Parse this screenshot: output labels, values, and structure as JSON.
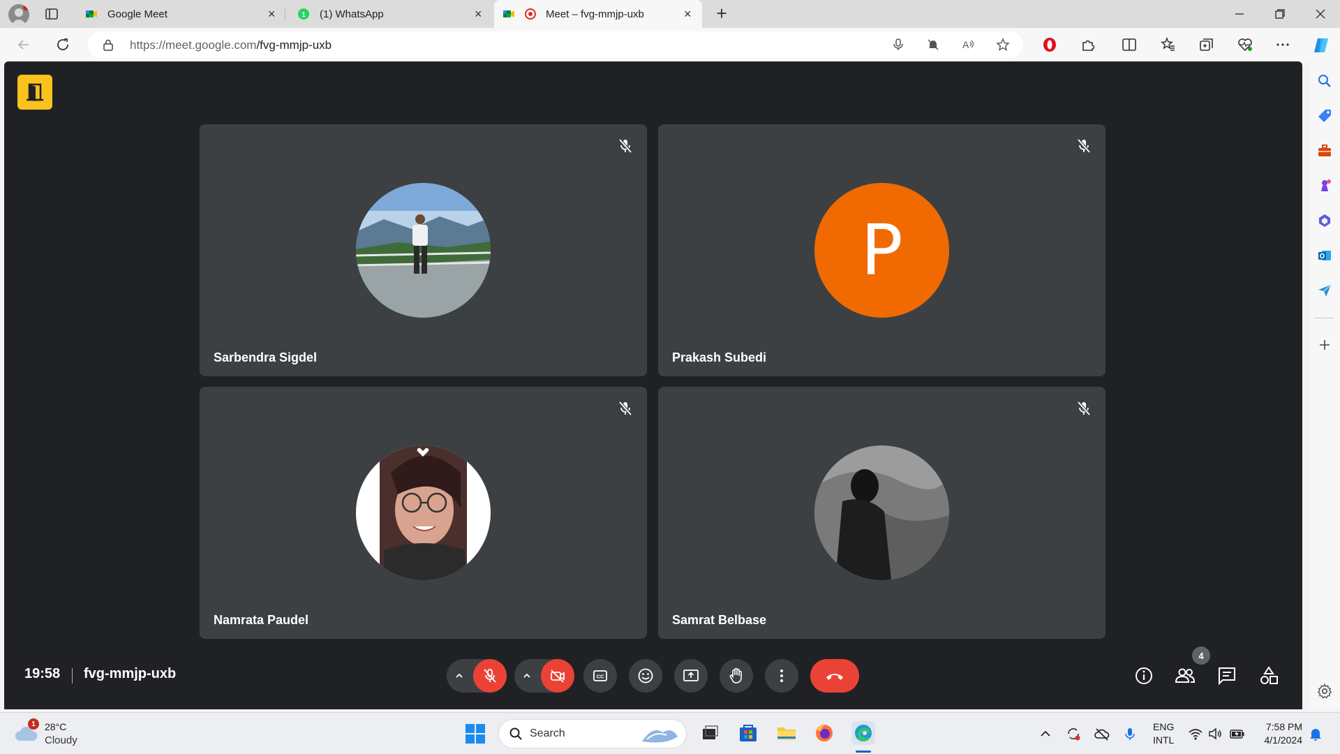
{
  "browser": {
    "tabs": [
      {
        "title": "Google Meet",
        "icon": "google-meet-icon",
        "active": false
      },
      {
        "title": "(1) WhatsApp",
        "icon": "whatsapp-icon",
        "active": false
      },
      {
        "title": "Meet – fvg-mmjp-uxb",
        "icon": "google-meet-icon",
        "active": true
      }
    ],
    "url_host": "https://meet.google.com",
    "url_path": "/fvg-mmjp-uxb"
  },
  "meet": {
    "participants": [
      {
        "name": "Sarbendra Sigdel",
        "avatar": "photo",
        "muted": true
      },
      {
        "name": "Prakash Subedi",
        "avatar": "letter",
        "initial": "P",
        "avatar_color": "#f06a01",
        "muted": true
      },
      {
        "name": "Namrata Paudel",
        "avatar": "photo",
        "muted": true
      },
      {
        "name": "Samrat Belbase",
        "avatar": "photo",
        "muted": true
      }
    ],
    "time": "19:58",
    "meeting_code": "fvg-mmjp-uxb",
    "people_count": "4",
    "colors": {
      "background": "#202124",
      "tile": "#3c4043",
      "danger": "#ea4335",
      "logo": "#f9c21d"
    }
  },
  "taskbar": {
    "weather_alerts": "1",
    "temperature": "28°C",
    "condition": "Cloudy",
    "search_label": "Search",
    "lang_top": "ENG",
    "lang_bottom": "INTL",
    "time": "7:58 PM",
    "date": "4/1/2024"
  }
}
